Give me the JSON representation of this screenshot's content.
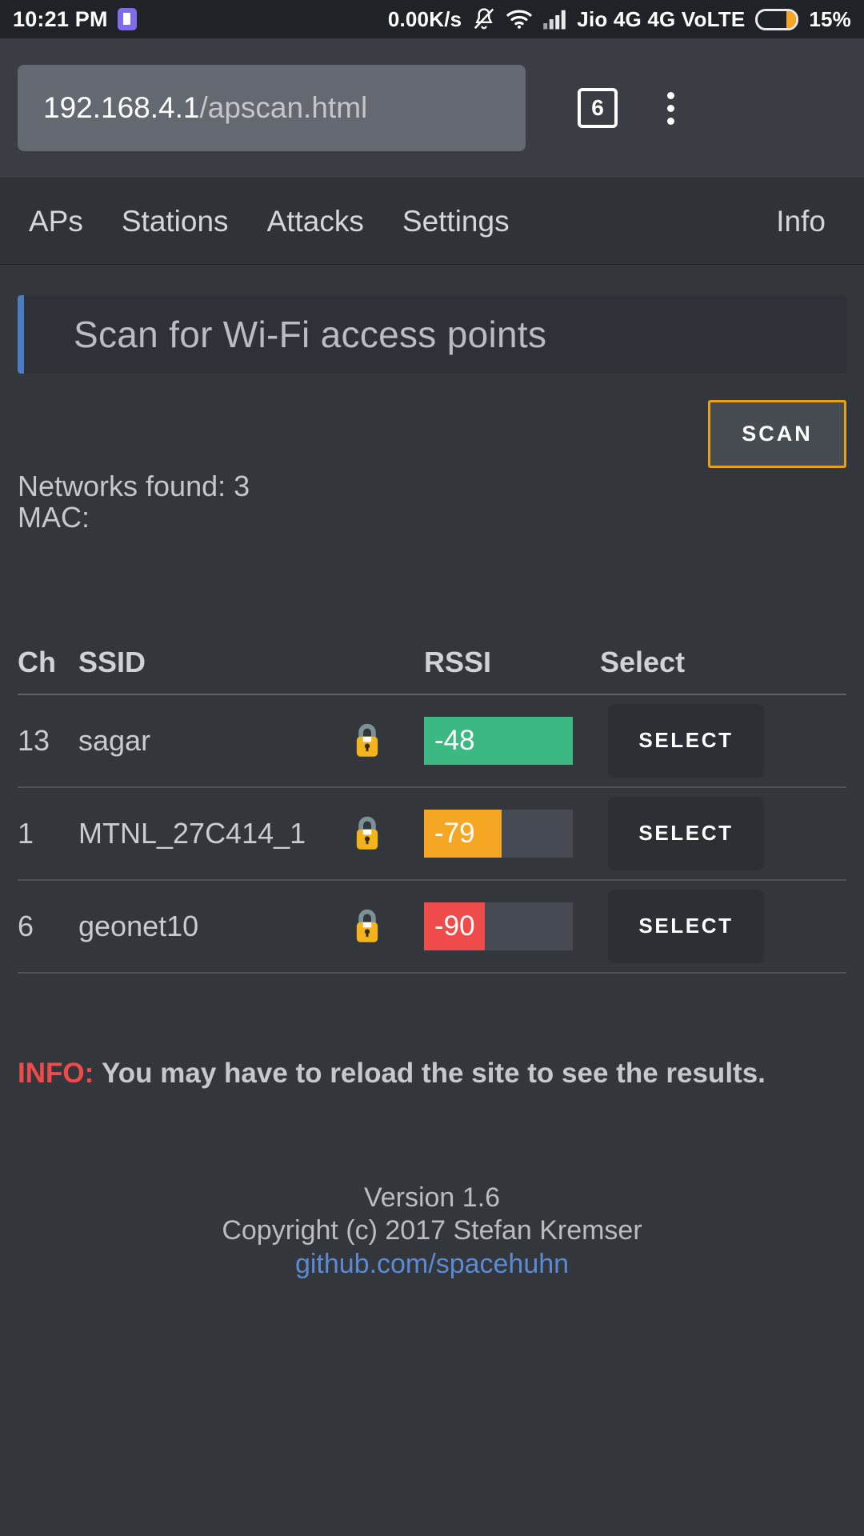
{
  "statusbar": {
    "time": "10:21 PM",
    "app_icon": "app-badge-icon",
    "network_speed": "0.00K/s",
    "mute_icon": "bell-muted-icon",
    "wifi_icon": "wifi-icon",
    "signal_icon": "signal-bars-icon",
    "carrier": "Jio 4G 4G VoLTE",
    "battery_icon": "battery-icon",
    "battery_percent": "15%"
  },
  "browser": {
    "url_host": "192.168.4.1",
    "url_path": "/apscan.html",
    "tab_count": "6",
    "menu_icon": "kebab-menu-icon"
  },
  "nav": {
    "items": [
      {
        "label": "APs"
      },
      {
        "label": "Stations"
      },
      {
        "label": "Attacks"
      },
      {
        "label": "Settings"
      }
    ],
    "right_item": {
      "label": "Info"
    }
  },
  "main": {
    "title": "Scan for Wi-Fi access points",
    "scan_button": "SCAN",
    "networks_found_label": "Networks found: 3",
    "mac_label": "MAC:",
    "table": {
      "headers": {
        "ch": "Ch",
        "ssid": "SSID",
        "rssi": "RSSI",
        "select": "Select"
      },
      "select_label": "SELECT",
      "lock_icon": "padlock-icon",
      "rows": [
        {
          "ch": "13",
          "ssid": "sagar",
          "encrypted": true,
          "rssi": "-48",
          "rssi_fill_pct": 100,
          "rssi_color": "#3cb882"
        },
        {
          "ch": "1",
          "ssid": "MTNL_27C414_1",
          "encrypted": true,
          "rssi": "-79",
          "rssi_fill_pct": 52,
          "rssi_color": "#f5a623"
        },
        {
          "ch": "6",
          "ssid": "geonet10",
          "encrypted": true,
          "rssi": "-90",
          "rssi_fill_pct": 41,
          "rssi_color": "#ef4b4b"
        }
      ]
    },
    "info_key": "INFO:",
    "info_text": "You may have to reload the site to see the results."
  },
  "footer": {
    "version": "Version 1.6",
    "copyright": "Copyright (c) 2017 Stefan Kremser",
    "link": "github.com/spacehuhn"
  },
  "colors": {
    "background": "#33373c",
    "accent_orange": "#e8a117",
    "accent_blue": "#4a7cc4",
    "link_blue": "#5b8ad4",
    "info_red": "#ef4b4b"
  }
}
